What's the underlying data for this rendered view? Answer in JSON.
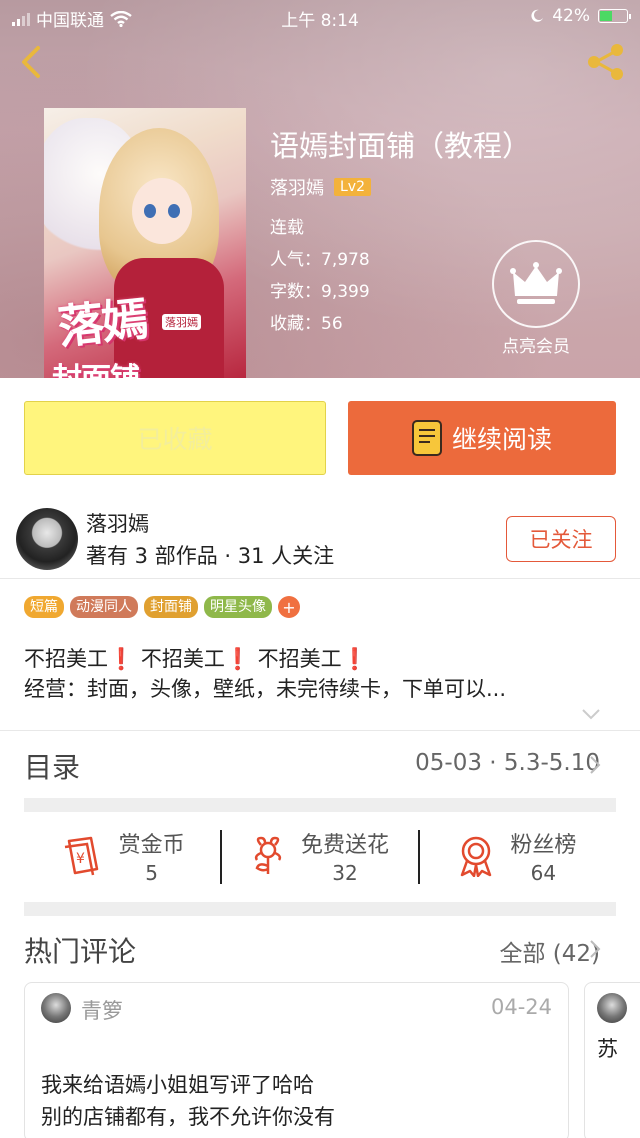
{
  "status_bar": {
    "carrier": "中国联通",
    "time": "上午 8:14",
    "battery": "42%",
    "battery_level": 0.42
  },
  "icons": {
    "back": "chevron-left-icon",
    "share": "share-icon",
    "member": "crown-icon",
    "book": "book-icon",
    "coin": "coin-red-envelope-icon",
    "flower": "flower-icon",
    "medal": "medal-icon",
    "chevron": "chevron-right-icon"
  },
  "colors": {
    "accent": "#ec6a3c",
    "favorite_button": "#fff57d",
    "follow": "#e4593a",
    "level_badge": "#f3b23b"
  },
  "book": {
    "title": "语嫣封面铺（教程）",
    "author": "落羽嫣",
    "level": "Lv2",
    "status": "连载",
    "popularity": "人气：7,978",
    "word_count": "字数：9,399",
    "favorites": "收藏：56",
    "member_label": "点亮会员",
    "cover_title_top": "落嫣",
    "cover_title_bottom": "封面铺",
    "cover_mini": "落羽嫣"
  },
  "buttons": {
    "favorited": "已收藏",
    "continue_reading": "继续阅读"
  },
  "author": {
    "name": "落羽嫣",
    "summary": "著有 3 部作品 · 31 人关注",
    "follow_label": "已关注"
  },
  "tags": [
    {
      "label": "短篇",
      "color": "#f0a830"
    },
    {
      "label": "动漫同人",
      "color": "#d07a5a"
    },
    {
      "label": "封面铺",
      "color": "#e0a030"
    },
    {
      "label": "明星头像",
      "color": "#8fb84a"
    }
  ],
  "tag_more": "+",
  "tag_more_color": "#f07040",
  "description": {
    "line1_parts": [
      "不招美工",
      "❗",
      " 不招美工",
      "❗",
      " 不招美工",
      "❗"
    ],
    "line2": "经营：封面，头像，壁纸，未完待续卡，下单可以..."
  },
  "toc": {
    "title": "目录",
    "latest": "05-03 · 5.3-5.10"
  },
  "actions": [
    {
      "label": "赏金币",
      "count": "5"
    },
    {
      "label": "免费送花",
      "count": "32"
    },
    {
      "label": "粉丝榜",
      "count": "64"
    }
  ],
  "comments": {
    "title": "热门评论",
    "all_label": "全部 (42)",
    "items": [
      {
        "user": "青箩",
        "date": "04-24",
        "lines": [
          "我来给语嫣小姐姐写评了哈哈",
          "别的店铺都有，我不允许你没有"
        ]
      },
      {
        "user": "",
        "date": "",
        "lines": [
          "苏"
        ]
      }
    ]
  }
}
